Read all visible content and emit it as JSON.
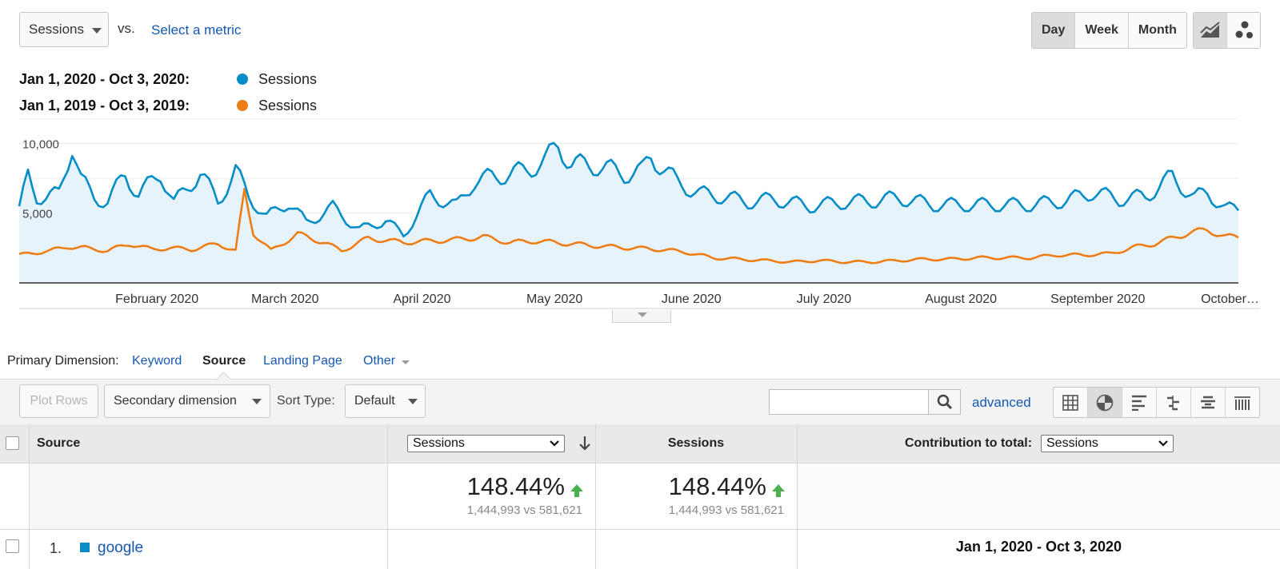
{
  "metric_selector": {
    "value": "Sessions",
    "vs": "vs.",
    "select_metric": "Select a metric"
  },
  "granularity": {
    "day": "Day",
    "week": "Week",
    "month": "Month"
  },
  "legend": [
    {
      "range": "Jan 1, 2020 - Oct 3, 2020:",
      "name": "Sessions",
      "color": "#058dc7"
    },
    {
      "range": "Jan 1, 2019 - Oct 3, 2019:",
      "name": "Sessions",
      "color": "#ed7e17"
    }
  ],
  "chart_data": {
    "type": "area",
    "x_range": [
      "2020-01-01",
      "2020-10-03"
    ],
    "ylim": [
      0,
      11000
    ],
    "y_ticks": [
      "10,000",
      "5,000"
    ],
    "x_tick_labels": [
      "February 2020",
      "March 2020",
      "April 2020",
      "May 2020",
      "June 2020",
      "July 2020",
      "August 2020",
      "September 2020",
      "October…"
    ],
    "series": [
      {
        "name": "Sessions",
        "color": "#058dc7",
        "anchors": [
          [
            1,
            5200
          ],
          [
            3,
            7700
          ],
          [
            5,
            6200
          ],
          [
            7,
            6100
          ],
          [
            10,
            6400
          ],
          [
            13,
            9900
          ],
          [
            15,
            7400
          ],
          [
            18,
            6100
          ],
          [
            21,
            5800
          ],
          [
            25,
            7800
          ],
          [
            28,
            6300
          ],
          [
            33,
            7900
          ],
          [
            36,
            5700
          ],
          [
            42,
            7900
          ],
          [
            46,
            5800
          ],
          [
            50,
            8000
          ],
          [
            53,
            6200
          ],
          [
            57,
            4700
          ],
          [
            62,
            5800
          ],
          [
            66,
            4300
          ],
          [
            72,
            5400
          ],
          [
            78,
            3800
          ],
          [
            84,
            4500
          ],
          [
            88,
            3400
          ],
          [
            94,
            6300
          ],
          [
            100,
            5500
          ],
          [
            104,
            7300
          ],
          [
            110,
            7700
          ],
          [
            115,
            8000
          ],
          [
            120,
            8700
          ],
          [
            123,
            9900
          ],
          [
            126,
            8500
          ],
          [
            132,
            8400
          ],
          [
            138,
            7800
          ],
          [
            142,
            8000
          ],
          [
            144,
            9100
          ],
          [
            150,
            7200
          ],
          [
            155,
            6400
          ],
          [
            160,
            6200
          ],
          [
            166,
            5800
          ],
          [
            172,
            6000
          ],
          [
            180,
            5500
          ],
          [
            188,
            5800
          ],
          [
            195,
            5900
          ],
          [
            200,
            6100
          ],
          [
            208,
            5600
          ],
          [
            215,
            5600
          ],
          [
            222,
            5600
          ],
          [
            230,
            5600
          ],
          [
            238,
            5900
          ],
          [
            244,
            6500
          ],
          [
            250,
            6000
          ],
          [
            256,
            6200
          ],
          [
            262,
            7600
          ],
          [
            267,
            6100
          ],
          [
            270,
            6500
          ],
          [
            274,
            5300
          ]
        ]
      },
      {
        "name": "Sessions",
        "color": "#ed7e17",
        "anchors": [
          [
            1,
            2000
          ],
          [
            8,
            2300
          ],
          [
            12,
            2600
          ],
          [
            16,
            2500
          ],
          [
            21,
            2300
          ],
          [
            26,
            2800
          ],
          [
            31,
            2400
          ],
          [
            35,
            2500
          ],
          [
            40,
            2400
          ],
          [
            46,
            2800
          ],
          [
            50,
            2300
          ],
          [
            52,
            6500
          ],
          [
            54,
            3600
          ],
          [
            58,
            2300
          ],
          [
            64,
            3500
          ],
          [
            70,
            2900
          ],
          [
            74,
            2300
          ],
          [
            80,
            3200
          ],
          [
            88,
            2900
          ],
          [
            94,
            3000
          ],
          [
            100,
            3100
          ],
          [
            106,
            3300
          ],
          [
            112,
            2900
          ],
          [
            118,
            3000
          ],
          [
            126,
            2800
          ],
          [
            134,
            2600
          ],
          [
            140,
            2500
          ],
          [
            146,
            2400
          ],
          [
            152,
            2200
          ],
          [
            158,
            1800
          ],
          [
            164,
            1700
          ],
          [
            170,
            1600
          ],
          [
            176,
            1500
          ],
          [
            182,
            1600
          ],
          [
            188,
            1500
          ],
          [
            194,
            1500
          ],
          [
            200,
            1600
          ],
          [
            206,
            1700
          ],
          [
            212,
            1700
          ],
          [
            218,
            1800
          ],
          [
            224,
            1800
          ],
          [
            230,
            1800
          ],
          [
            236,
            2000
          ],
          [
            242,
            2000
          ],
          [
            248,
            2100
          ],
          [
            254,
            2600
          ],
          [
            258,
            2800
          ],
          [
            262,
            3200
          ],
          [
            266,
            3600
          ],
          [
            270,
            3800
          ],
          [
            274,
            3300
          ]
        ]
      }
    ]
  },
  "primary_dimension": {
    "label": "Primary Dimension:",
    "keyword": "Keyword",
    "source": "Source",
    "landing_page": "Landing Page",
    "other": "Other"
  },
  "toolbar": {
    "plot_rows": "Plot Rows",
    "secondary_dimension": "Secondary dimension",
    "sort_type_label": "Sort Type:",
    "sort_type_value": "Default",
    "search_value": "",
    "advanced": "advanced"
  },
  "table": {
    "headers": {
      "source": "Source",
      "metric_select": "Sessions",
      "sessions": "Sessions",
      "contribution_label": "Contribution to total:",
      "contribution_select": "Sessions"
    },
    "totals": [
      {
        "pct": "148.44%",
        "sub": "1,444,993 vs 581,621"
      },
      {
        "pct": "148.44%",
        "sub": "1,444,993 vs 581,621"
      }
    ],
    "rows": [
      {
        "index": "1.",
        "source": "google",
        "color": "#058dc7"
      }
    ],
    "date_header": "Jan 1, 2020 - Oct 3, 2020"
  }
}
